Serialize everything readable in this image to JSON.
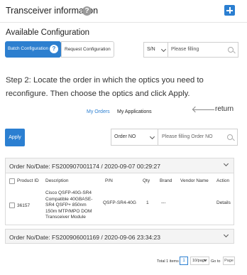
{
  "header": {
    "title": "Transceiver information",
    "help_glyph": "?"
  },
  "available": {
    "title": "Available Configuration"
  },
  "tabs": {
    "batch": "Batch Configuration",
    "request": "Request Configuration",
    "help_glyph": "?"
  },
  "search_top": {
    "select_value": "S/N",
    "placeholder": "Please filling"
  },
  "step_text": "Step 2: Locate the order in which the optics you need to reconfigure. Then choose the optics and click Apply.",
  "order_tabs": {
    "my_orders": "My Orders",
    "my_applications": "My Applications"
  },
  "return_label": "return",
  "apply_label": "Apply",
  "search_order": {
    "select_value": "Order NO",
    "placeholder": "Please filling Order NO"
  },
  "order1": {
    "header": "Order No/Date: FS200907001174 / 2020-09-07 00:29:27",
    "columns": [
      "Product ID",
      "Description",
      "P/N",
      "Qty",
      "Brand",
      "Vendor Name",
      "Action"
    ],
    "row": {
      "product_id": "36157",
      "description": "Cisco QSFP-40G-SR4 Compatible 40GBASE-SR4 QSFP+ 850nm 150m MTP/MPO DOM Transceiver Module",
      "pn": "QSFP-SR4-40G",
      "qty": "1",
      "brand": "---",
      "vendor": "",
      "action": "Details"
    }
  },
  "order2": {
    "header": "Order No/Date: FS200906001169 / 2020-09-06 23:34:23"
  },
  "pagination": {
    "total": "Total 1 items",
    "current_page": "1",
    "page_size": "10/page",
    "goto_label": "Go to",
    "goto_placeholder": "Page"
  },
  "colors": {
    "accent": "#2b7fd1"
  }
}
